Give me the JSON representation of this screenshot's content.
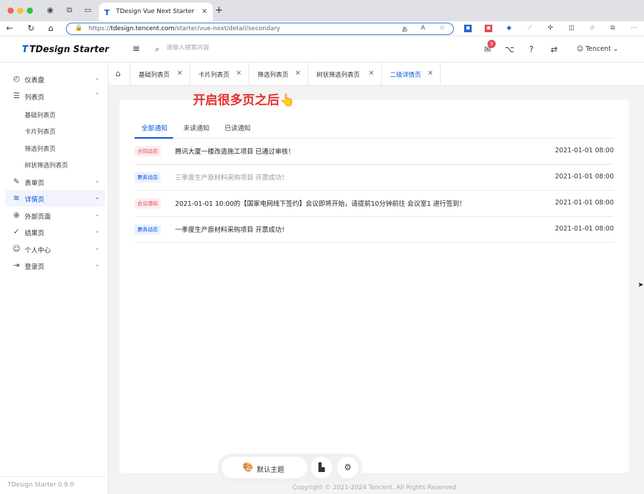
{
  "browser": {
    "tab_title": "TDesign Vue Next Starter",
    "tab_favicon": "T",
    "tab_close": "×",
    "new_tab": "+",
    "url_scheme": "https://",
    "url_host": "tdesign.tencent.com",
    "url_path": "/starter/vue-next/detail/secondary",
    "back": "←",
    "refresh": "↻",
    "home": "⌂"
  },
  "header": {
    "logo": "TDesign Starter",
    "logo_mark": "T",
    "menu_icon": "≡",
    "search_placeholder": "请输入搜索内容",
    "notification_count": "3",
    "user_name": "Tencent",
    "user_caret": "⌄"
  },
  "sidebar": {
    "items": [
      {
        "icon": "dashboard-icon",
        "glyph": "◴",
        "label": "仪表盘",
        "caret": "⌄"
      },
      {
        "icon": "list-icon",
        "glyph": "☰",
        "label": "列表页",
        "caret": "⌃"
      },
      {
        "icon": "edit-icon",
        "glyph": "✎",
        "label": "表单页",
        "caret": "⌄"
      },
      {
        "icon": "layers-icon",
        "glyph": "≋",
        "label": "详情页",
        "caret": "⌄"
      },
      {
        "icon": "globe-icon",
        "glyph": "⊕",
        "label": "外部页面",
        "caret": "⌄"
      },
      {
        "icon": "check-circle-icon",
        "glyph": "✓",
        "label": "结果页",
        "caret": "⌄"
      },
      {
        "icon": "user-circle-icon",
        "glyph": "☺",
        "label": "个人中心",
        "caret": "⌄"
      },
      {
        "icon": "login-icon",
        "glyph": "⇥",
        "label": "登录页",
        "caret": "⌄"
      }
    ],
    "sub_items": [
      "基础列表页",
      "卡片列表页",
      "筛选列表页",
      "树状筛选列表页"
    ],
    "footer": "TDesign Starter 0.9.0"
  },
  "page_tabs": {
    "home_icon": "⌂",
    "close": "×",
    "tabs": [
      "基础列表页",
      "卡片列表页",
      "筛选列表页",
      "树状筛选列表页",
      "二级详情页"
    ]
  },
  "annotation": "开启很多页之后👆",
  "notices": {
    "tabs": [
      "全部通知",
      "未读通知",
      "已读通知"
    ],
    "rows": [
      {
        "tag": "合同动态",
        "tag_color": "red",
        "content": "腾讯大厦一楼改造施工项目 已通过审核！",
        "time": "2021-01-01 08:00",
        "read": false
      },
      {
        "tag": "票务动态",
        "tag_color": "blue",
        "content": "三季度生产原材料采购项目 开票成功！",
        "time": "2021-01-01 08:00",
        "read": true
      },
      {
        "tag": "会议通知",
        "tag_color": "red",
        "content": "2021-01-01 10:00的【国家电网线下签约】会议即将开始，请提前10分钟前往 会议室1 进行签到！",
        "time": "2021-01-01 08:00",
        "read": false
      },
      {
        "tag": "票务动态",
        "tag_color": "blue",
        "content": "一季度生产原材料采购项目 开票成功！",
        "time": "2021-01-01 08:00",
        "read": false
      }
    ]
  },
  "toolbar": {
    "theme_label": "默认主题"
  },
  "footer": {
    "copyright": "Copyright © 2021-2024 Tencent. All Rights Reserved"
  },
  "colors": {
    "brand": "#0052d9",
    "danger": "#e34d59",
    "annotation": "#e6302b"
  }
}
